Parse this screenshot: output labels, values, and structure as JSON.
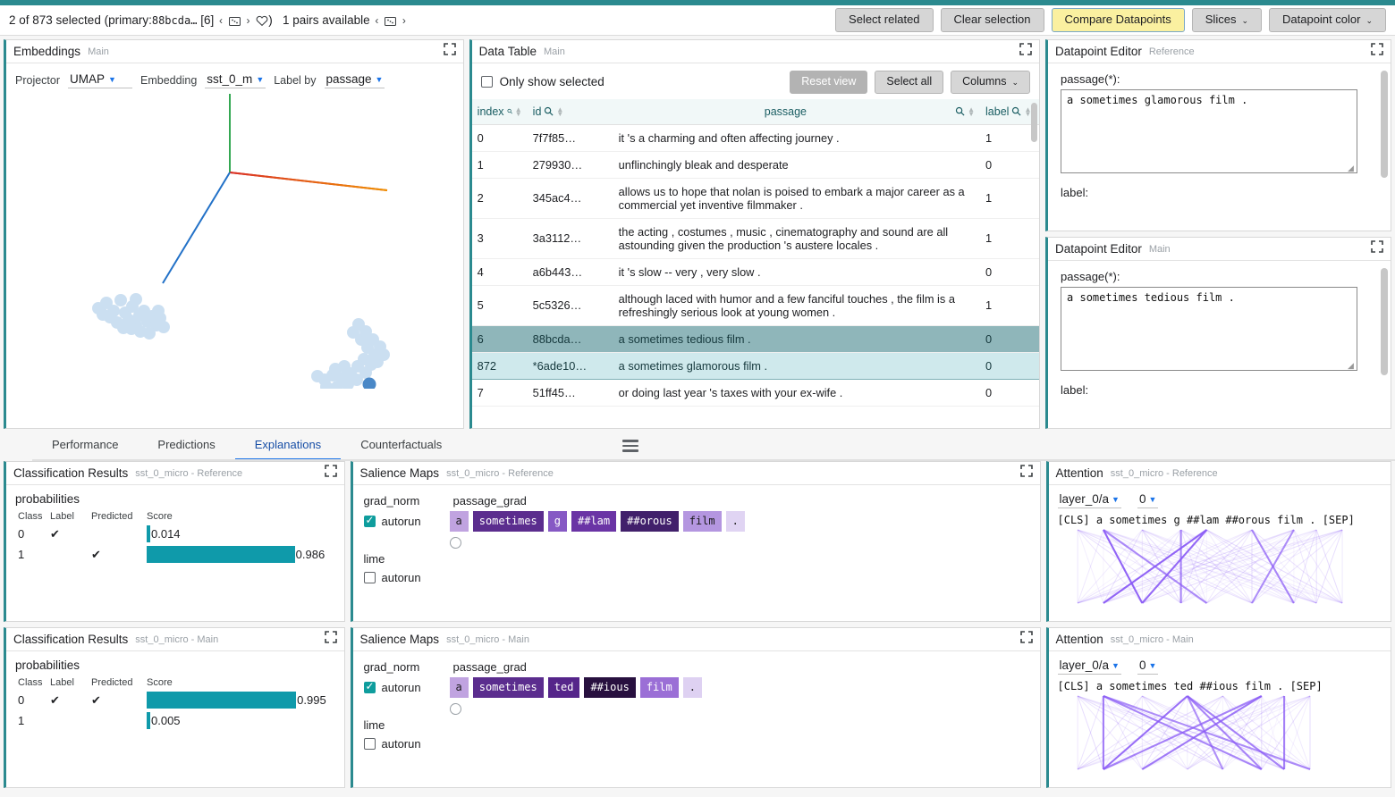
{
  "toolbar": {
    "selection_text": "2 of 873 selected",
    "primary_prefix": "(primary:",
    "primary_id": "88bcda…",
    "primary_index": "[6]",
    "pairs_text": "1 pairs available",
    "buttons": {
      "select_related": "Select related",
      "clear_selection": "Clear selection",
      "compare_datapoints": "Compare Datapoints",
      "slices": "Slices",
      "datapoint_color": "Datapoint color"
    },
    "icons": {
      "prev": "‹",
      "next": "›",
      "random": "⊡",
      "favorite": "♡",
      "caret": "⌄"
    },
    "accent_color": "#2b8a8f",
    "highlight_color": "#faf0a0"
  },
  "embeddings": {
    "title": "Embeddings",
    "subtitle": "Main",
    "controls": {
      "projector_label": "Projector",
      "projector_value": "UMAP",
      "embedding_label": "Embedding",
      "embedding_value": "sst_0_m",
      "labelby_label": "Label by",
      "labelby_value": "passage"
    },
    "axis_colors": {
      "x": "#d93025",
      "y": "#34a853",
      "z": "#1a73e8"
    },
    "point_color": "#aacbe8",
    "selected_point_color": "#4a88c7"
  },
  "data_table": {
    "title": "Data Table",
    "subtitle": "Main",
    "only_show_selected": "Only show selected",
    "only_show_selected_checked": false,
    "buttons": {
      "reset_view": "Reset view",
      "select_all": "Select all",
      "columns": "Columns"
    },
    "columns": [
      "index",
      "id",
      "passage",
      "label"
    ],
    "rows": [
      {
        "index": "0",
        "id": "7f7f85…",
        "passage": "it 's a charming and often affecting journey .",
        "label": "1",
        "state": "normal"
      },
      {
        "index": "1",
        "id": "279930…",
        "passage": "unflinchingly bleak and desperate",
        "label": "0",
        "state": "normal"
      },
      {
        "index": "2",
        "id": "345ac4…",
        "passage": "allows us to hope that nolan is poised to embark a major career as a commercial yet inventive filmmaker .",
        "label": "1",
        "state": "normal"
      },
      {
        "index": "3",
        "id": "3a3112…",
        "passage": "the acting , costumes , music , cinematography and sound are all astounding given the production 's austere locales .",
        "label": "1",
        "state": "normal"
      },
      {
        "index": "4",
        "id": "a6b443…",
        "passage": "it 's slow -- very , very slow .",
        "label": "0",
        "state": "normal"
      },
      {
        "index": "5",
        "id": "5c5326…",
        "passage": "although laced with humor and a few fanciful touches , the film is a refreshingly serious look at young women .",
        "label": "1",
        "state": "normal"
      },
      {
        "index": "6",
        "id": "88bcda…",
        "passage": "a sometimes tedious film .",
        "label": "0",
        "state": "primary"
      },
      {
        "index": "872",
        "id": "*6ade10…",
        "passage": "a sometimes glamorous film .",
        "label": "0",
        "state": "secondary"
      },
      {
        "index": "7",
        "id": "51ff45…",
        "passage": "or doing last year 's taxes with your ex-wife .",
        "label": "0",
        "state": "normal"
      }
    ]
  },
  "datapoint_editors": [
    {
      "title": "Datapoint Editor",
      "subtitle": "Reference",
      "passage_label": "passage(*):",
      "passage_value": "a sometimes glamorous film .",
      "label_label": "label:"
    },
    {
      "title": "Datapoint Editor",
      "subtitle": "Main",
      "passage_label": "passage(*):",
      "passage_value": "a sometimes tedious film .",
      "label_label": "label:"
    }
  ],
  "tabs": {
    "items": [
      "Performance",
      "Predictions",
      "Explanations",
      "Counterfactuals"
    ],
    "active": "Explanations"
  },
  "classification_results": [
    {
      "title": "Classification Results",
      "subtitle": "sst_0_micro - Reference",
      "section": "probabilities",
      "headers": [
        "Class",
        "Label",
        "Predicted",
        "Score"
      ],
      "rows": [
        {
          "class": "0",
          "label": "✔",
          "predicted": "",
          "score": "0.014",
          "value": 0.014
        },
        {
          "class": "1",
          "label": "",
          "predicted": "✔",
          "score": "0.986",
          "value": 0.986
        }
      ],
      "bar_color": "#0f9aaa"
    },
    {
      "title": "Classification Results",
      "subtitle": "sst_0_micro - Main",
      "section": "probabilities",
      "headers": [
        "Class",
        "Label",
        "Predicted",
        "Score"
      ],
      "rows": [
        {
          "class": "0",
          "label": "✔",
          "predicted": "✔",
          "score": "0.995",
          "value": 0.995
        },
        {
          "class": "1",
          "label": "",
          "predicted": "",
          "score": "0.005",
          "value": 0.005
        }
      ],
      "bar_color": "#0f9aaa"
    }
  ],
  "salience_maps": [
    {
      "title": "Salience Maps",
      "subtitle": "sst_0_micro - Reference",
      "method_grad": "grad_norm",
      "field_name": "passage_grad",
      "autorun_label": "autorun",
      "grad_autorun_checked": true,
      "method_lime": "lime",
      "lime_autorun_checked": false,
      "tokens": [
        {
          "text": "a",
          "color": "#c0a3e0",
          "fg": "#1a1a1a"
        },
        {
          "text": "sometimes",
          "color": "#5b2d8e",
          "fg": "#ffffff"
        },
        {
          "text": "g",
          "color": "#8659c4",
          "fg": "#ffffff"
        },
        {
          "text": "##lam",
          "color": "#6a34a5",
          "fg": "#ffffff"
        },
        {
          "text": "##orous",
          "color": "#41206b",
          "fg": "#ffffff"
        },
        {
          "text": "film",
          "color": "#b496e0",
          "fg": "#1a1a1a"
        },
        {
          "text": ".",
          "color": "#e0d4f3",
          "fg": "#1a1a1a"
        }
      ]
    },
    {
      "title": "Salience Maps",
      "subtitle": "sst_0_micro - Main",
      "method_grad": "grad_norm",
      "field_name": "passage_grad",
      "autorun_label": "autorun",
      "grad_autorun_checked": true,
      "method_lime": "lime",
      "lime_autorun_checked": false,
      "tokens": [
        {
          "text": "a",
          "color": "#c0a3e0",
          "fg": "#1a1a1a"
        },
        {
          "text": "sometimes",
          "color": "#5b2d8e",
          "fg": "#ffffff"
        },
        {
          "text": "ted",
          "color": "#55258a",
          "fg": "#ffffff"
        },
        {
          "text": "##ious",
          "color": "#28103f",
          "fg": "#ffffff"
        },
        {
          "text": "film",
          "color": "#9b6fd6",
          "fg": "#ffffff"
        },
        {
          "text": ".",
          "color": "#ded1f2",
          "fg": "#1a1a1a"
        }
      ]
    }
  ],
  "attention": [
    {
      "title": "Attention",
      "subtitle": "sst_0_micro - Reference",
      "layer_value": "layer_0/a",
      "head_value": "0",
      "tokens_line": "[CLS] a sometimes g ##lam ##orous film . [SEP]",
      "tokens": [
        "[CLS]",
        "a",
        "sometimes",
        "g",
        "##lam",
        "##orous",
        "film",
        ".",
        "[SEP]"
      ],
      "line_color": "#8b5cf6"
    },
    {
      "title": "Attention",
      "subtitle": "sst_0_micro - Main",
      "layer_value": "layer_0/a",
      "head_value": "0",
      "tokens_line": "[CLS] a sometimes ted ##ious film . [SEP]",
      "tokens": [
        "[CLS]",
        "a",
        "sometimes",
        "ted",
        "##ious",
        "film",
        ".",
        "[SEP]"
      ],
      "line_color": "#8b5cf6"
    }
  ],
  "icons": {
    "expand": "⛶"
  }
}
